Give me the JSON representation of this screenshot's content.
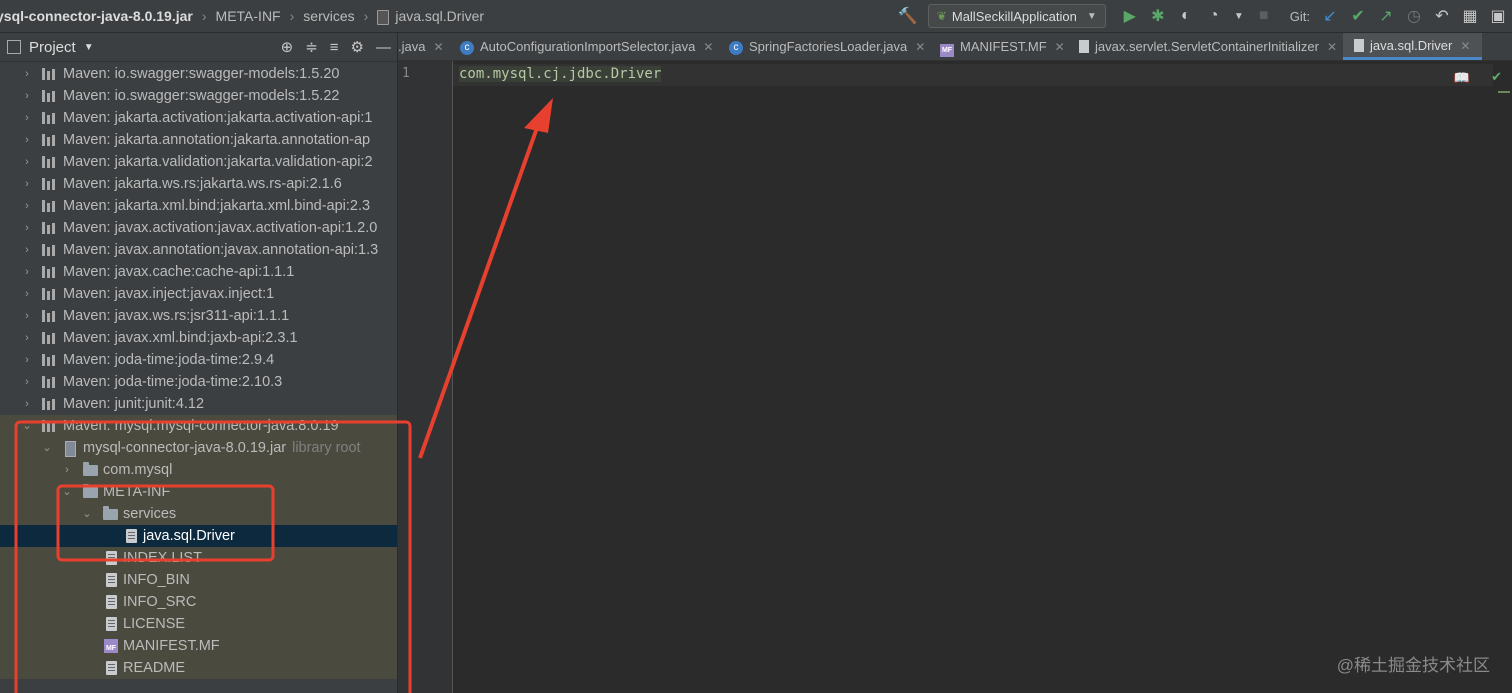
{
  "breadcrumbs": {
    "jar": "ysql-connector-java-8.0.19.jar",
    "meta_inf": "META-INF",
    "services": "services",
    "file": "java.sql.Driver"
  },
  "toolbar": {
    "run_config": "MallSeckillApplication",
    "git_label": "Git:"
  },
  "project_pane": {
    "title": "Project",
    "tree": [
      {
        "label": "Maven: io.swagger:swagger-models:1.5.20"
      },
      {
        "label": "Maven: io.swagger:swagger-models:1.5.22"
      },
      {
        "label": "Maven: jakarta.activation:jakarta.activation-api:1"
      },
      {
        "label": "Maven: jakarta.annotation:jakarta.annotation-ap"
      },
      {
        "label": "Maven: jakarta.validation:jakarta.validation-api:2"
      },
      {
        "label": "Maven: jakarta.ws.rs:jakarta.ws.rs-api:2.1.6"
      },
      {
        "label": "Maven: jakarta.xml.bind:jakarta.xml.bind-api:2.3"
      },
      {
        "label": "Maven: javax.activation:javax.activation-api:1.2.0"
      },
      {
        "label": "Maven: javax.annotation:javax.annotation-api:1.3"
      },
      {
        "label": "Maven: javax.cache:cache-api:1.1.1"
      },
      {
        "label": "Maven: javax.inject:javax.inject:1"
      },
      {
        "label": "Maven: javax.ws.rs:jsr311-api:1.1.1"
      },
      {
        "label": "Maven: javax.xml.bind:jaxb-api:2.3.1"
      },
      {
        "label": "Maven: joda-time:joda-time:2.9.4"
      },
      {
        "label": "Maven: joda-time:joda-time:2.10.3"
      },
      {
        "label": "Maven: junit:junit:4.12"
      },
      {
        "label": "Maven: mysql:mysql-connector-java:8.0.19"
      },
      {
        "label": "mysql-connector-java-8.0.19.jar",
        "suffix": "library root"
      },
      {
        "label": "com.mysql"
      },
      {
        "label": "META-INF"
      },
      {
        "label": "services"
      },
      {
        "label": "java.sql.Driver"
      },
      {
        "label": "INDEX.LIST"
      },
      {
        "label": "INFO_BIN"
      },
      {
        "label": "INFO_SRC"
      },
      {
        "label": "LICENSE"
      },
      {
        "label": "MANIFEST.MF"
      },
      {
        "label": "README"
      }
    ]
  },
  "tabs": [
    {
      "label": ".java"
    },
    {
      "label": "AutoConfigurationImportSelector.java"
    },
    {
      "label": "SpringFactoriesLoader.java"
    },
    {
      "label": "MANIFEST.MF"
    },
    {
      "label": "javax.servlet.ServletContainerInitializer"
    },
    {
      "label": "java.sql.Driver"
    }
  ],
  "editor": {
    "line_number": "1",
    "code": "com.mysql.cj.jdbc.Driver"
  },
  "watermark": "@稀土掘金技术社区",
  "colors": {
    "annotation_red": "#e8402e",
    "selection_blue": "#0d293e",
    "tab_underline": "#4a88c7"
  }
}
